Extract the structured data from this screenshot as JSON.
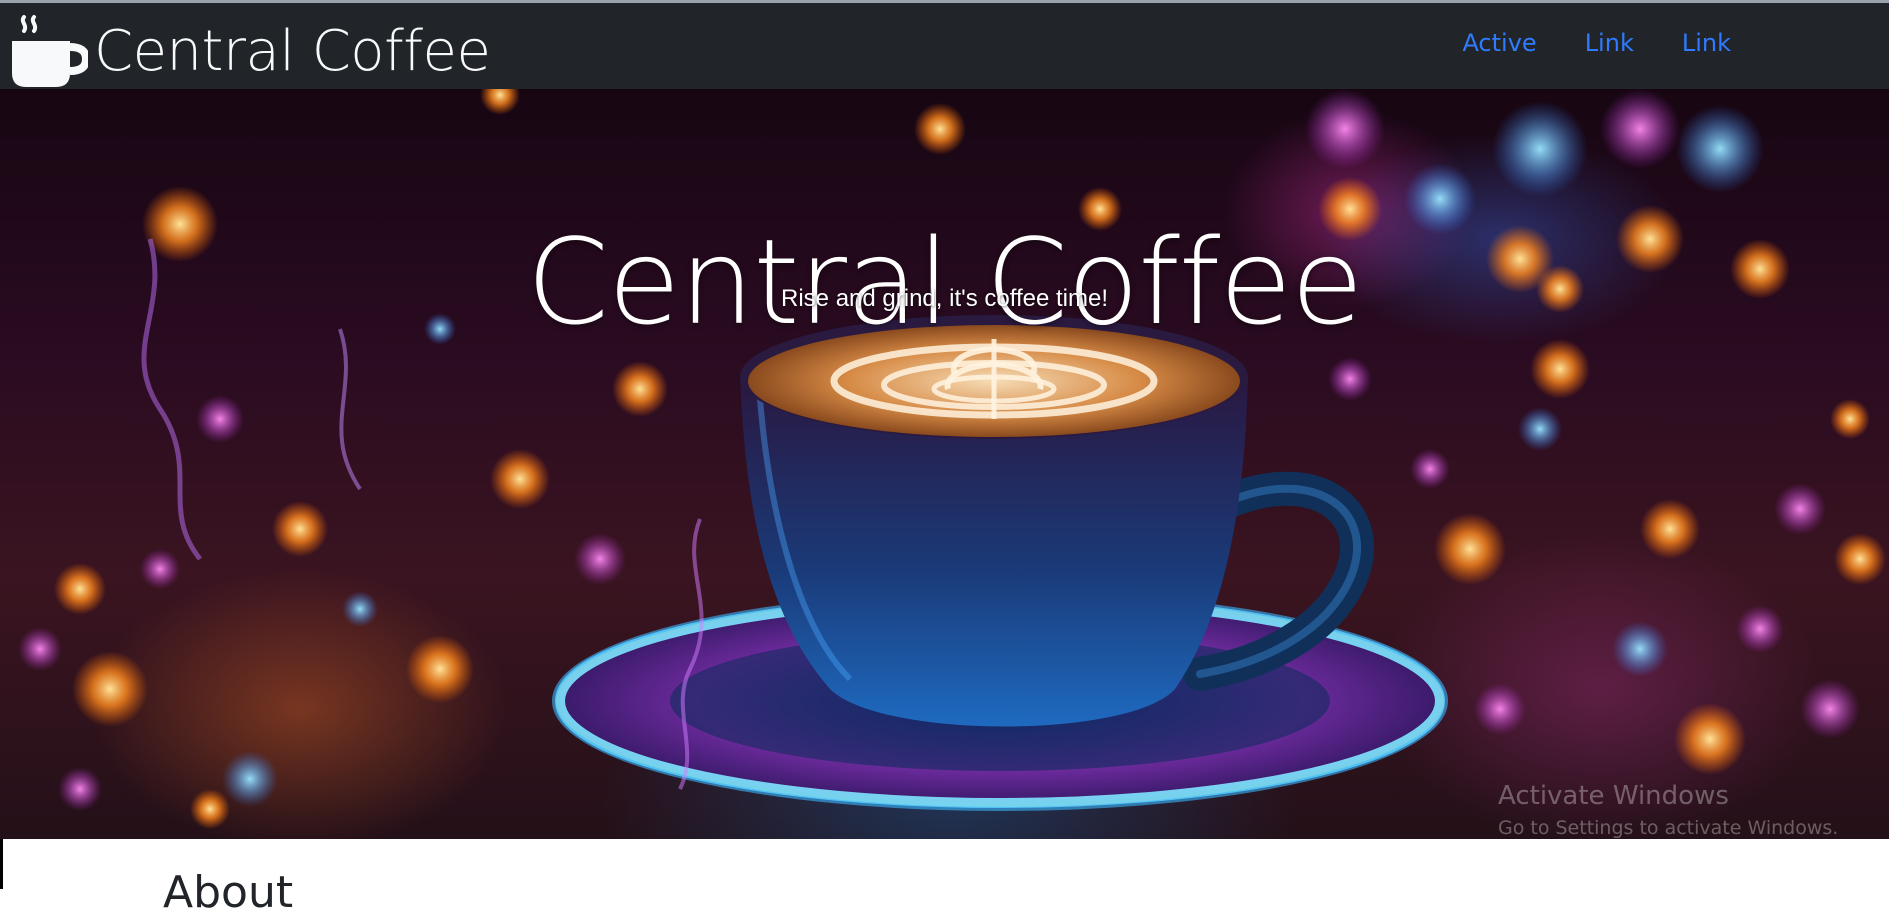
{
  "navbar": {
    "brand_icon": "coffee-cup-icon",
    "brand": "Central Coffee",
    "links": [
      "Active",
      "Link",
      "Link"
    ],
    "link_color": "#2f7bff",
    "background": "#212529"
  },
  "hero": {
    "title": "Central Coffee",
    "subtitle": "Rise and grind, it's coffee time!",
    "image_alt": "Latte art coffee cup on glowing saucer"
  },
  "watermark": {
    "line1": "Activate Windows",
    "line2": "Go to Settings to activate Windows."
  },
  "about": {
    "heading": "About"
  }
}
